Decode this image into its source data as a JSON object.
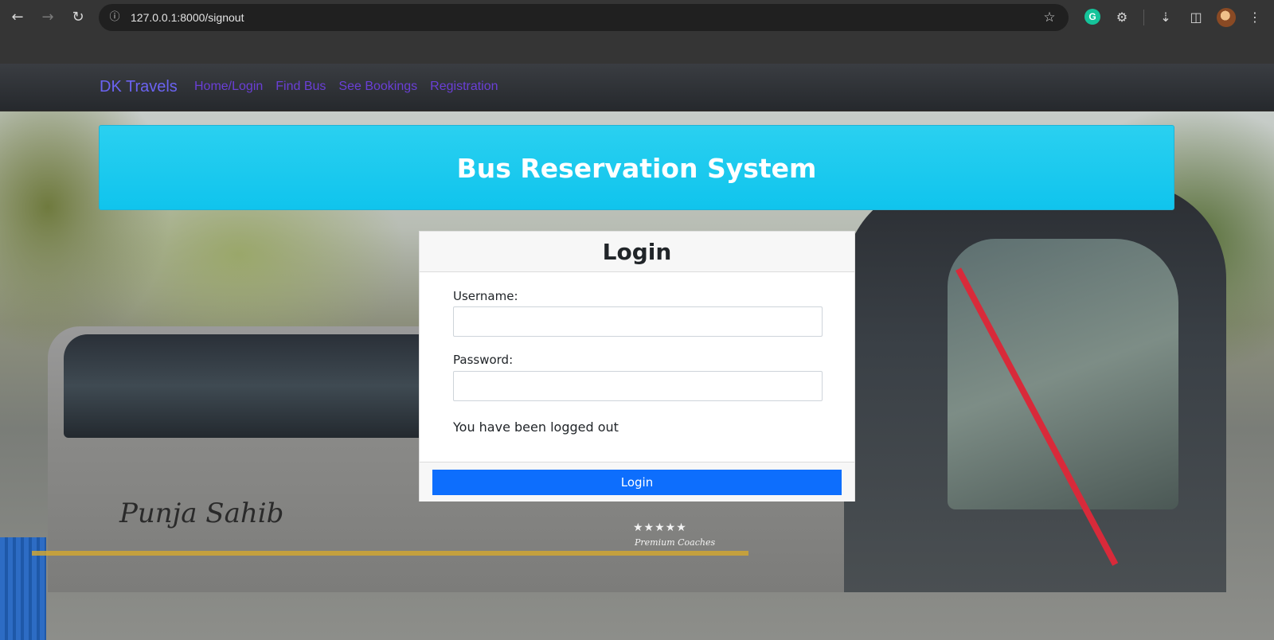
{
  "browser": {
    "url": "127.0.0.1:8000/signout",
    "back_icon": "arrow-left-icon",
    "forward_icon": "arrow-right-icon",
    "reload_icon": "reload-icon",
    "grammarly_letter": "G"
  },
  "navbar": {
    "brand": "DK Travels",
    "links": [
      "Home/Login",
      "Find Bus",
      "See Bookings",
      "Registration"
    ]
  },
  "hero": {
    "title": "Bus Reservation System"
  },
  "login": {
    "title": "Login",
    "username_label": "Username:",
    "username_value": "",
    "password_label": "Password:",
    "password_value": "",
    "message": "You have been logged out",
    "button": "Login"
  },
  "background_photo": {
    "bus_logo": "Punja Sahib",
    "bus_stars": "★★★★★",
    "bus_tag": "Premium Coaches"
  },
  "colors": {
    "brand": "#6b63f2",
    "nav_link": "#6a3fd6",
    "hero": "#10c4ed",
    "primary_button": "#0d6efd"
  }
}
